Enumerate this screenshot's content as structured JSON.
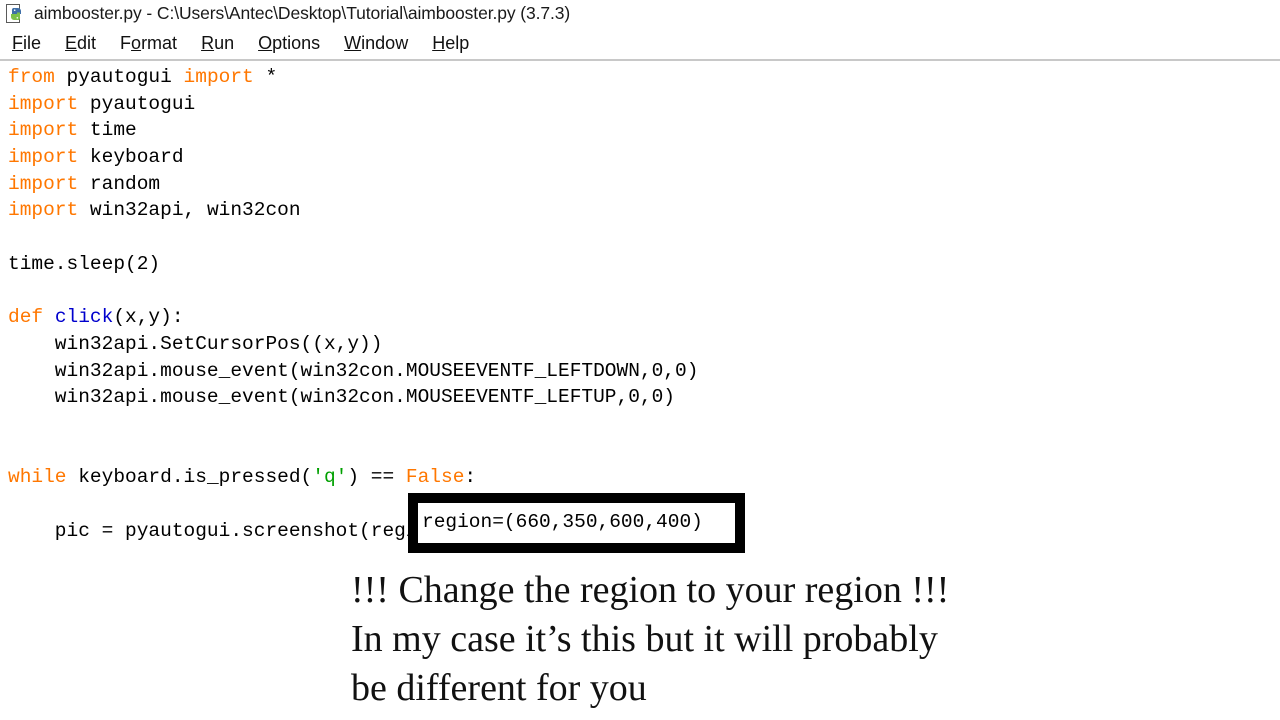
{
  "window": {
    "title": "aimbooster.py - C:\\Users\\Antec\\Desktop\\Tutorial\\aimbooster.py (3.7.3)",
    "icon": "python-idle-icon"
  },
  "menubar": {
    "items": [
      {
        "label": "File",
        "accel": "F",
        "before": "",
        "after": "ile"
      },
      {
        "label": "Edit",
        "accel": "E",
        "before": "",
        "after": "dit"
      },
      {
        "label": "Format",
        "accel": "o",
        "before": "F",
        "after": "rmat"
      },
      {
        "label": "Run",
        "accel": "R",
        "before": "",
        "after": "un"
      },
      {
        "label": "Options",
        "accel": "O",
        "before": "",
        "after": "ptions"
      },
      {
        "label": "Window",
        "accel": "W",
        "before": "",
        "after": "indow"
      },
      {
        "label": "Help",
        "accel": "H",
        "before": "",
        "after": "elp"
      }
    ]
  },
  "editor": {
    "language": "python",
    "colors": {
      "keyword": "#ff7700",
      "definition": "#0000cd",
      "string": "#00a000",
      "text": "#000000",
      "background": "#ffffff"
    },
    "lines": [
      {
        "n": 1,
        "tokens": [
          {
            "t": "kw",
            "v": "from"
          },
          {
            "t": "plain",
            "v": " pyautogui "
          },
          {
            "t": "kw",
            "v": "import"
          },
          {
            "t": "plain",
            "v": " *"
          }
        ]
      },
      {
        "n": 2,
        "tokens": [
          {
            "t": "kw",
            "v": "import"
          },
          {
            "t": "plain",
            "v": " pyautogui"
          }
        ]
      },
      {
        "n": 3,
        "tokens": [
          {
            "t": "kw",
            "v": "import"
          },
          {
            "t": "plain",
            "v": " time"
          }
        ]
      },
      {
        "n": 4,
        "tokens": [
          {
            "t": "kw",
            "v": "import"
          },
          {
            "t": "plain",
            "v": " keyboard"
          }
        ]
      },
      {
        "n": 5,
        "tokens": [
          {
            "t": "kw",
            "v": "import"
          },
          {
            "t": "plain",
            "v": " random"
          }
        ]
      },
      {
        "n": 6,
        "tokens": [
          {
            "t": "kw",
            "v": "import"
          },
          {
            "t": "plain",
            "v": " win32api, win32con"
          }
        ]
      },
      {
        "n": 7,
        "tokens": []
      },
      {
        "n": 8,
        "tokens": [
          {
            "t": "plain",
            "v": "time.sleep(2)"
          }
        ]
      },
      {
        "n": 9,
        "tokens": []
      },
      {
        "n": 10,
        "tokens": [
          {
            "t": "kw",
            "v": "def"
          },
          {
            "t": "plain",
            "v": " "
          },
          {
            "t": "defname",
            "v": "click"
          },
          {
            "t": "plain",
            "v": "(x,y):"
          }
        ]
      },
      {
        "n": 11,
        "tokens": [
          {
            "t": "plain",
            "v": "    win32api.SetCursorPos((x,y))"
          }
        ]
      },
      {
        "n": 12,
        "tokens": [
          {
            "t": "plain",
            "v": "    win32api.mouse_event(win32con.MOUSEEVENTF_LEFTDOWN,0,0)"
          }
        ]
      },
      {
        "n": 13,
        "tokens": [
          {
            "t": "plain",
            "v": "    win32api.mouse_event(win32con.MOUSEEVENTF_LEFTUP,0,0)"
          }
        ]
      },
      {
        "n": 14,
        "tokens": []
      },
      {
        "n": 15,
        "tokens": []
      },
      {
        "n": 16,
        "tokens": [
          {
            "t": "kw",
            "v": "while"
          },
          {
            "t": "plain",
            "v": " keyboard.is_pressed("
          },
          {
            "t": "str",
            "v": "'q'"
          },
          {
            "t": "plain",
            "v": ") == "
          },
          {
            "t": "kw",
            "v": "False"
          },
          {
            "t": "plain",
            "v": ":"
          }
        ]
      },
      {
        "n": 17,
        "tokens": []
      },
      {
        "n": 18,
        "tokens": [
          {
            "t": "plain",
            "v": "    pic = pyautogui.screenshot(region=(660,350,600,400)"
          }
        ]
      }
    ]
  },
  "overlay": {
    "highlight_box": {
      "text": "region=(660,350,600,400)",
      "border_color": "#000000",
      "fill_color": "#ffffff"
    },
    "annotation": {
      "lines": [
        "!!! Change the region to your region !!!",
        "In my case it’s this but it will probably",
        "be different for you"
      ]
    }
  }
}
